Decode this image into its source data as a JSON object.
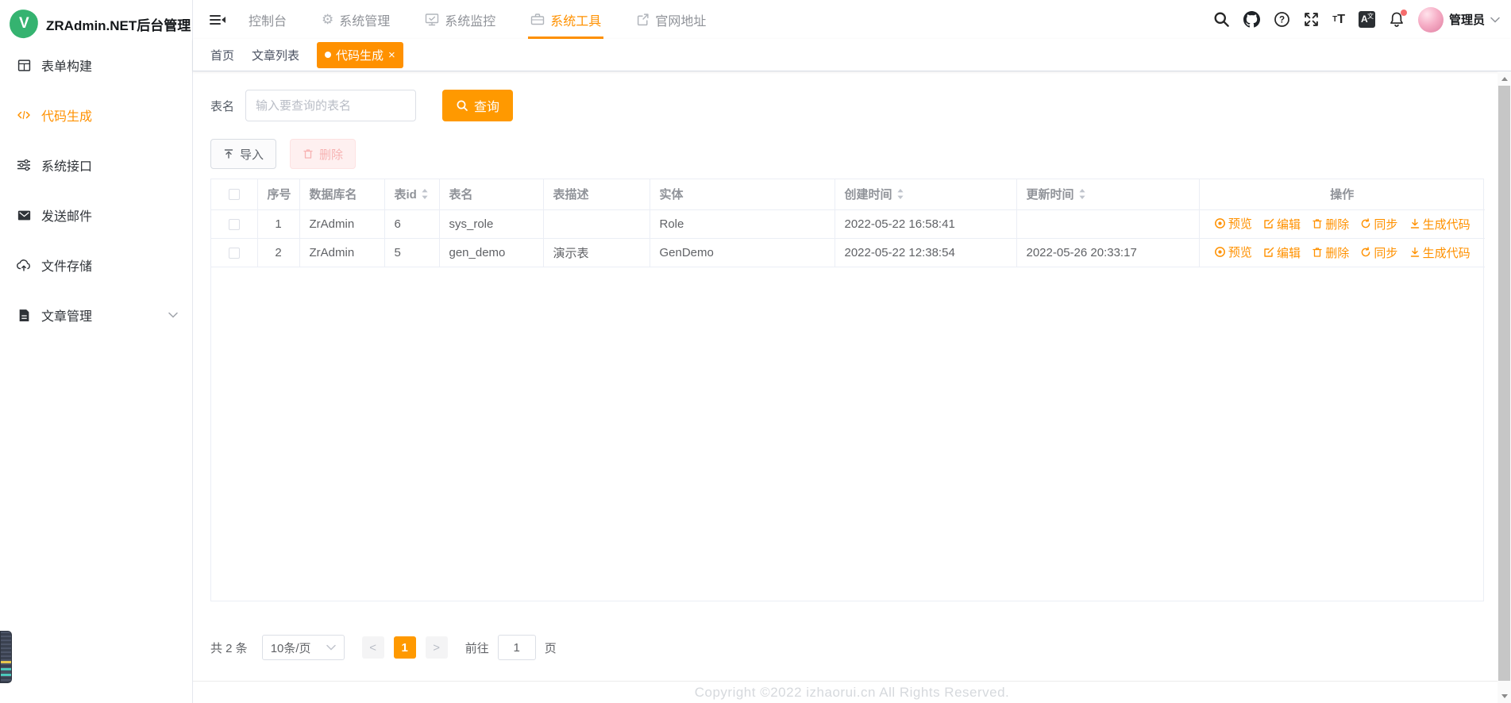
{
  "app": {
    "title": "ZRAdmin.NET后台管理"
  },
  "colors": {
    "accent": "#ff9100",
    "accent_button": "#ff9900",
    "logo_green": "#35b370",
    "danger_soft": "#fef0f0",
    "notification_dot": "#f56c6c"
  },
  "icons": {
    "close": "×",
    "help": "?",
    "font_small": "T",
    "font_big": "T",
    "lang_a": "A",
    "lang_wen": "文",
    "page_prev": "<",
    "page_next": ">"
  },
  "sidebar": {
    "items": [
      {
        "label": "表单构建",
        "icon": "form-grid-icon"
      },
      {
        "label": "代码生成",
        "icon": "code-icon",
        "active": true
      },
      {
        "label": "系统接口",
        "icon": "sliders-icon"
      },
      {
        "label": "发送邮件",
        "icon": "mail-icon"
      },
      {
        "label": "文件存储",
        "icon": "cloud-upload-icon"
      },
      {
        "label": "文章管理",
        "icon": "document-icon",
        "has_children": true
      }
    ]
  },
  "topnav": {
    "items": [
      {
        "label": "控制台"
      },
      {
        "label": "系统管理",
        "icon": "gear-icon"
      },
      {
        "label": "系统监控",
        "icon": "monitor-icon"
      },
      {
        "label": "系统工具",
        "icon": "toolbox-icon",
        "active": true
      },
      {
        "label": "官网地址",
        "icon": "external-link-icon"
      }
    ],
    "user": {
      "name": "管理员"
    }
  },
  "tabs": [
    {
      "label": "首页"
    },
    {
      "label": "文章列表"
    },
    {
      "label": "代码生成",
      "active": true,
      "closable": true
    }
  ],
  "search": {
    "label": "表名",
    "placeholder": "输入要查询的表名",
    "button_label": "查询"
  },
  "toolbar": {
    "import_label": "导入",
    "delete_label": "删除"
  },
  "table": {
    "headers": [
      "序号",
      "数据库名",
      "表id",
      "表名",
      "表描述",
      "实体",
      "创建时间",
      "更新时间",
      "操作"
    ],
    "rows": [
      {
        "no": "1",
        "db": "ZrAdmin",
        "tid": "6",
        "name": "sys_role",
        "desc": "",
        "entity": "Role",
        "created": "2022-05-22 16:58:41",
        "updated": ""
      },
      {
        "no": "2",
        "db": "ZrAdmin",
        "tid": "5",
        "name": "gen_demo",
        "desc": "演示表",
        "entity": "GenDemo",
        "created": "2022-05-22 12:38:54",
        "updated": "2022-05-26 20:33:17"
      }
    ],
    "actions": [
      "预览",
      "编辑",
      "删除",
      "同步",
      "生成代码"
    ]
  },
  "pagination": {
    "total": "共 2 条",
    "page_size": "10条/页",
    "current_page": "1",
    "goto_label": "前往",
    "goto_value": "1",
    "page_unit": "页"
  },
  "footer": {
    "copyright": "Copyright ©2022 izhaorui.cn All Rights Reserved."
  }
}
